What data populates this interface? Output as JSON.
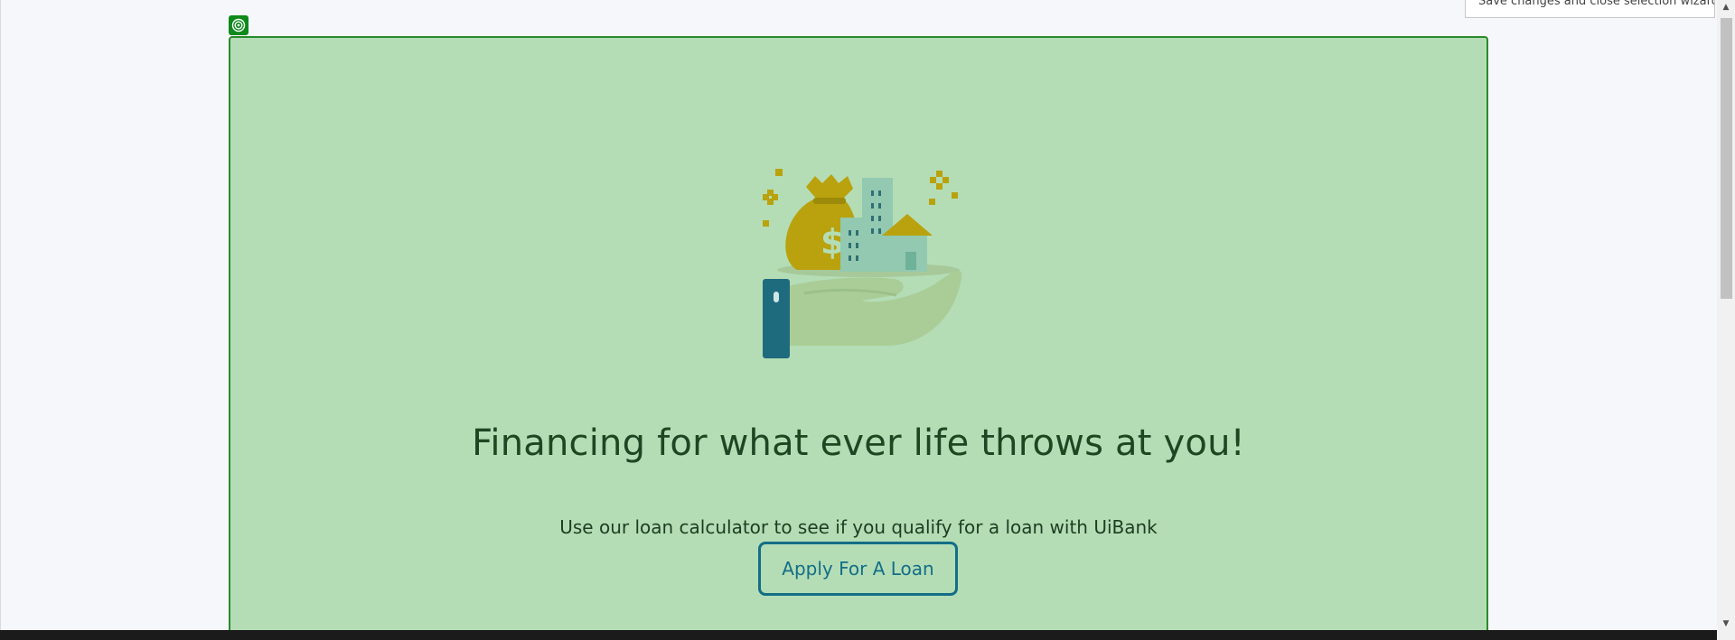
{
  "tooltip": {
    "text": "Save changes and close selection wizard."
  },
  "hero": {
    "headline": "Financing for what ever life throws at you!",
    "subtext": "Use our loan calculator to see if you qualify for a loan with UiBank",
    "apply_button_label": "Apply For A Loan",
    "illustration_icon": "hand-holding-money-bag-and-buildings-icon"
  },
  "selection_marker": {
    "icon": "target-icon"
  },
  "colors": {
    "page_background": "#f6f7fb",
    "hero_background": "#b4ddb6",
    "hero_border": "#2a8a2a",
    "headline": "#1d4722",
    "button_accent": "#136e86",
    "footer": "#1b1b1b"
  }
}
